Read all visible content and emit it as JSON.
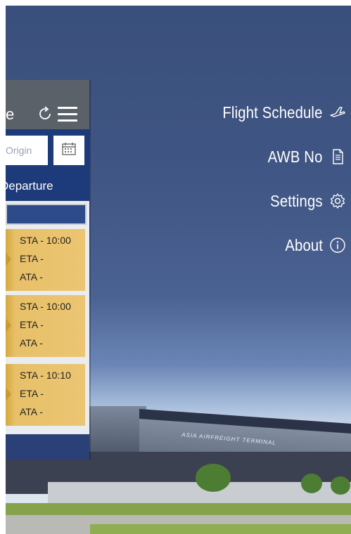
{
  "left_panel": {
    "title_fragment": "e",
    "origin_placeholder": "Origin",
    "tab_label": "Departure",
    "cards": [
      {
        "sta": "STA - 10:00",
        "eta": "ETA -",
        "ata": "ATA -"
      },
      {
        "sta": "STA - 10:00",
        "eta": "ETA -",
        "ata": "ATA -"
      },
      {
        "sta": "STA - 10:10",
        "eta": "ETA -",
        "ata": "ATA -"
      }
    ]
  },
  "side_menu": {
    "items": [
      {
        "label": "Flight Schedule",
        "icon": "airplane-icon"
      },
      {
        "label": "AWB No",
        "icon": "document-icon"
      },
      {
        "label": "Settings",
        "icon": "gear-icon"
      },
      {
        "label": "About",
        "icon": "info-icon"
      }
    ]
  },
  "background": {
    "building_sign": "ASIA AIRFREIGHT TERMINAL"
  },
  "colors": {
    "panel_header": "#5b6169",
    "panel_blue": "#1d3a7a",
    "card_gold": "#ecc573",
    "menu_text": "#ffffff"
  }
}
